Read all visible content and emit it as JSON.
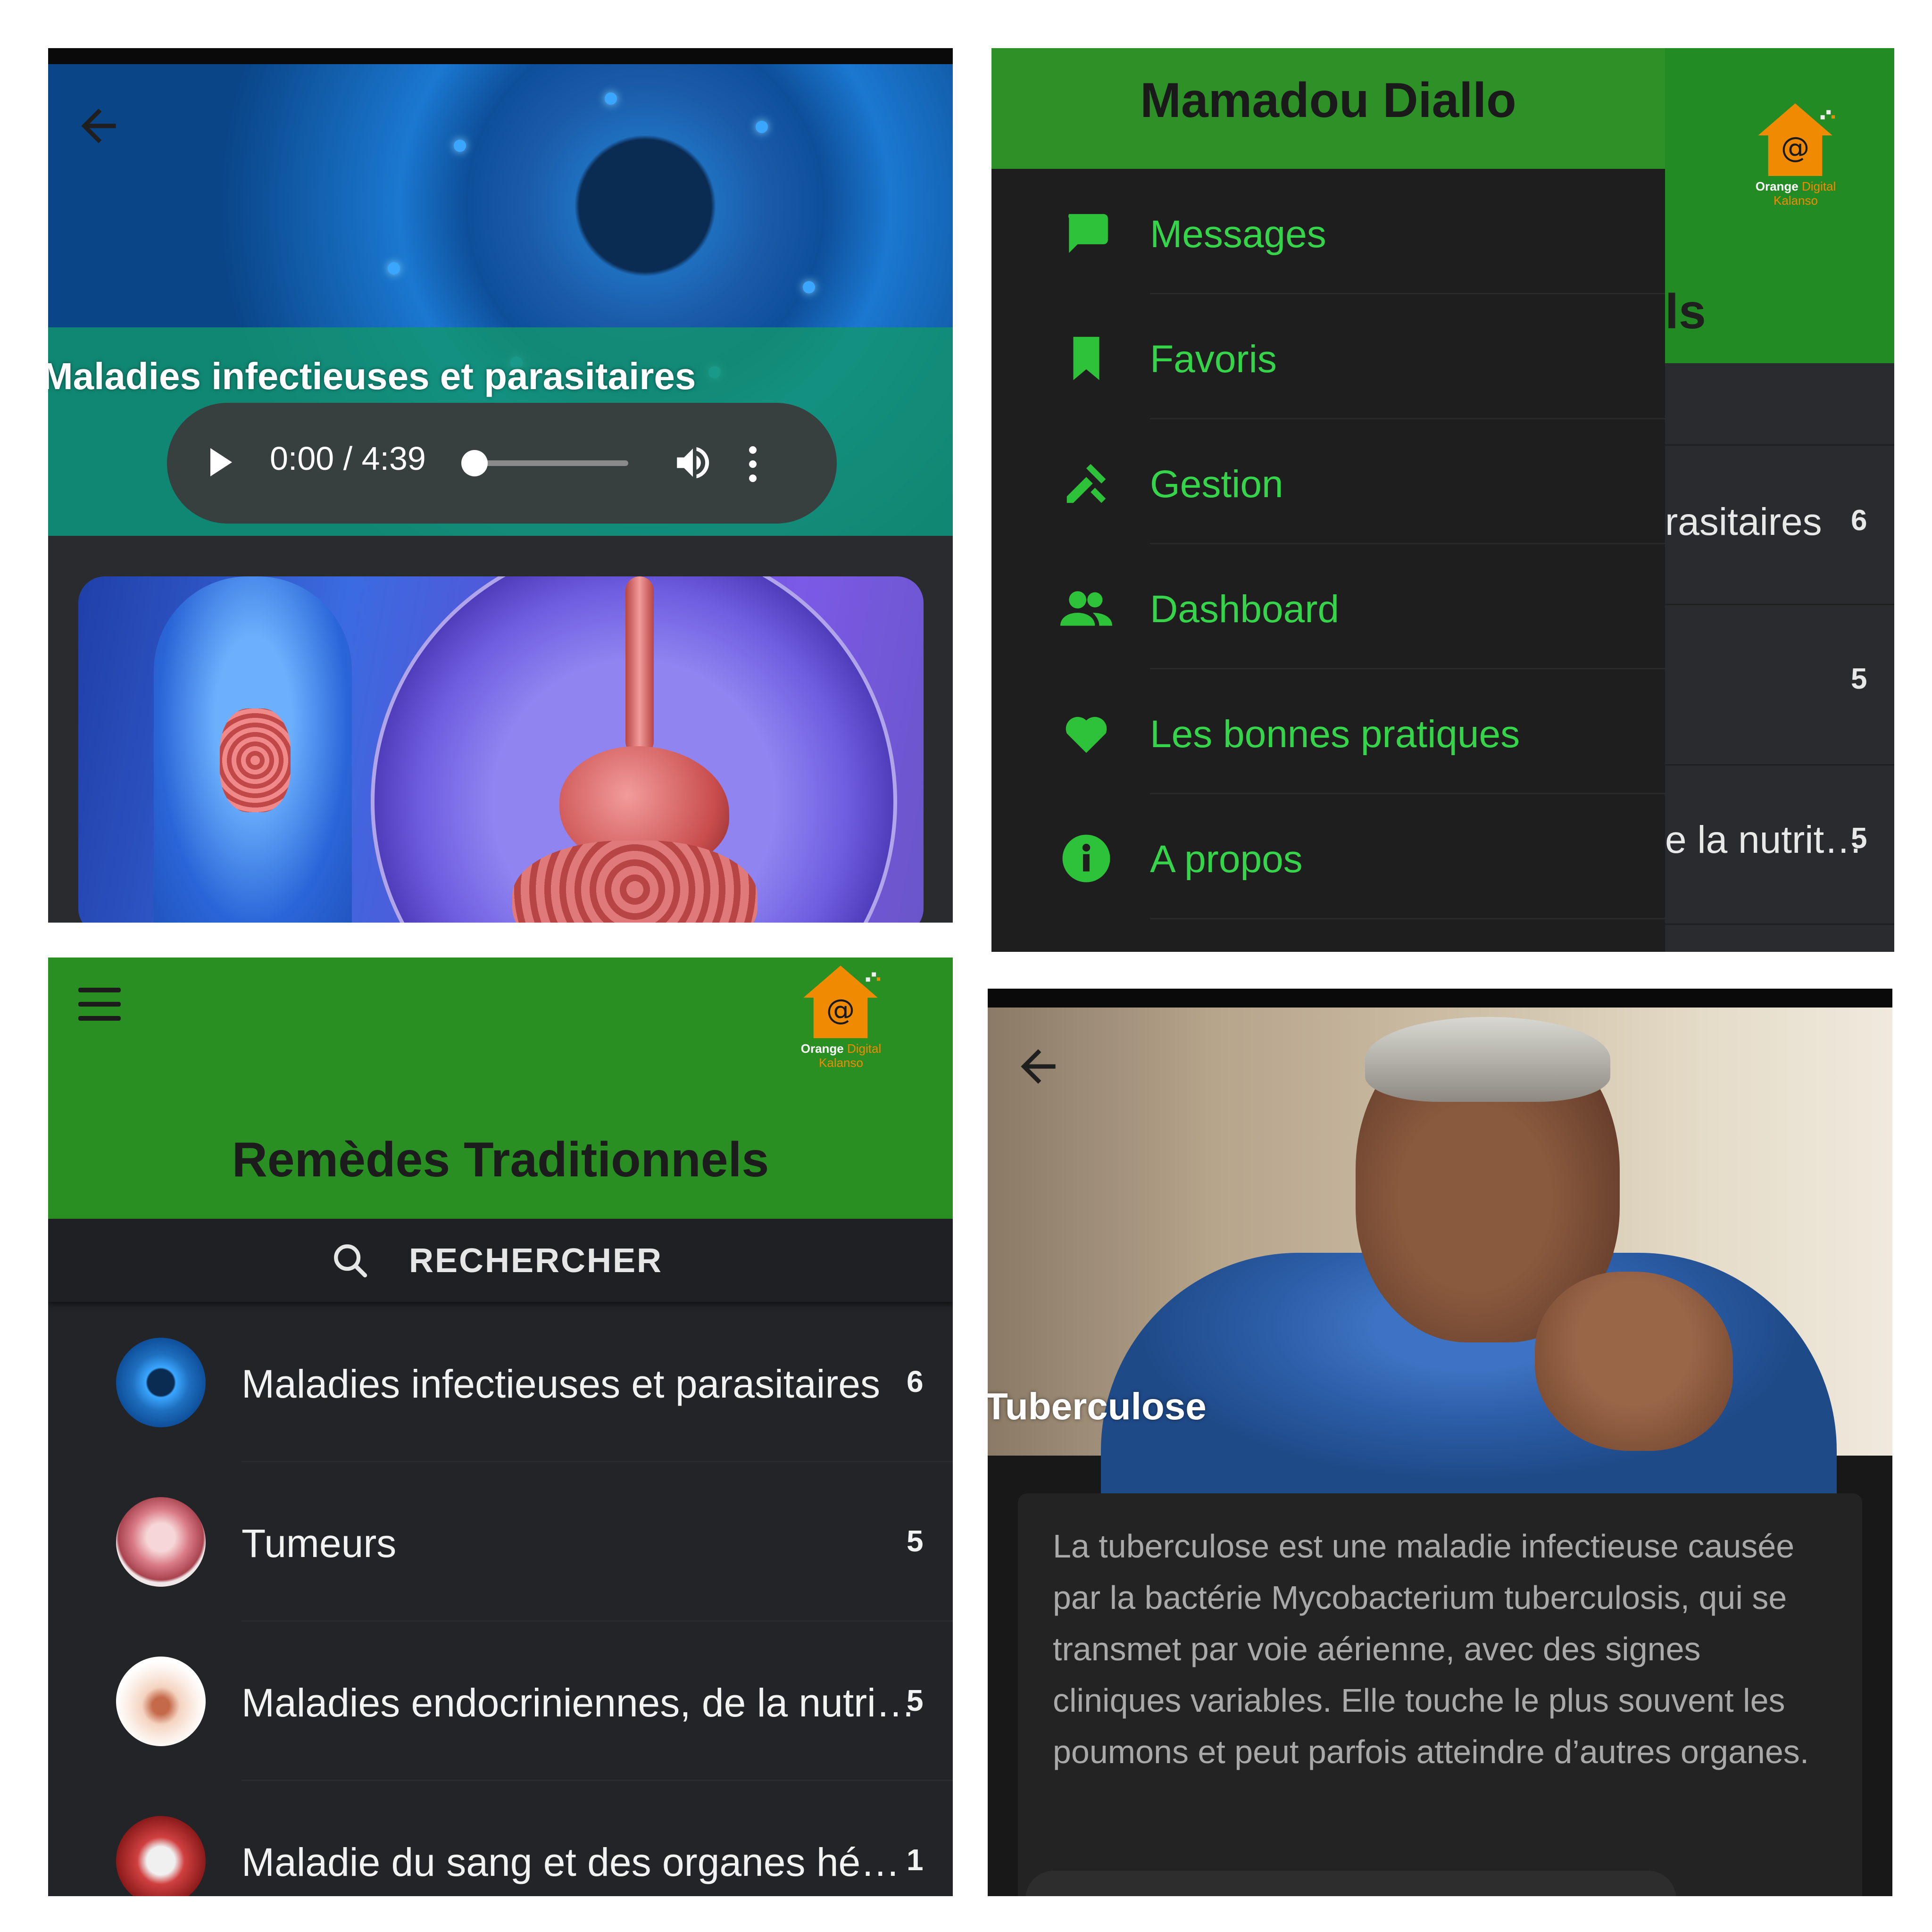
{
  "panel_audio": {
    "title": "Maladies infectieuses et parasitaires",
    "player": {
      "time": "0:00 / 4:39",
      "progress": 0
    }
  },
  "panel_drawer": {
    "user_name": "Mamadou Diallo",
    "items": [
      {
        "label": "Messages",
        "icon": "chat-bubble-icon"
      },
      {
        "label": "Favoris",
        "icon": "bookmark-icon"
      },
      {
        "label": "Gestion",
        "icon": "tools-icon"
      },
      {
        "label": "Dashboard",
        "icon": "people-icon"
      },
      {
        "label": "Les bonnes pratiques",
        "icon": "heart-icon"
      },
      {
        "label": "A propos",
        "icon": "info-icon"
      }
    ],
    "background": {
      "heading_fragment": "ls",
      "rows": [
        {
          "text": "rasitaires",
          "count": "6"
        },
        {
          "text": "",
          "count": "5"
        },
        {
          "text": "e la nutrit…",
          "count": "5"
        }
      ]
    }
  },
  "logo": {
    "word1": "Orange",
    "word2": "Digital",
    "word3": "Kalanso"
  },
  "panel_list": {
    "heading": "Remèdes Traditionnels",
    "search_label": "RECHERCHER",
    "rows": [
      {
        "label": "Maladies infectieuses et parasitaires",
        "count": "6",
        "thumb": "virus"
      },
      {
        "label": "Tumeurs",
        "count": "5",
        "thumb": "tumor"
      },
      {
        "label": "Maladies endocriniennes, de la nutrit…",
        "count": "5",
        "thumb": "thyroid"
      },
      {
        "label": "Maladie du sang et des organes hé…",
        "count": "1",
        "thumb": "blood"
      }
    ]
  },
  "panel_detail": {
    "title": "Tuberculose",
    "description": "La tuberculose est une maladie infectieuse causée par la bactérie Mycobacterium tuberculosis, qui se transmet par voie aérienne, avec des signes cliniques variables. Elle touche le plus souvent les poumons et peut parfois atteindre d’autres organes."
  },
  "colors": {
    "brand_green": "#2a8f23",
    "accent_green": "#36d44a",
    "dark_bg": "#232427",
    "orange": "#f08a00"
  }
}
